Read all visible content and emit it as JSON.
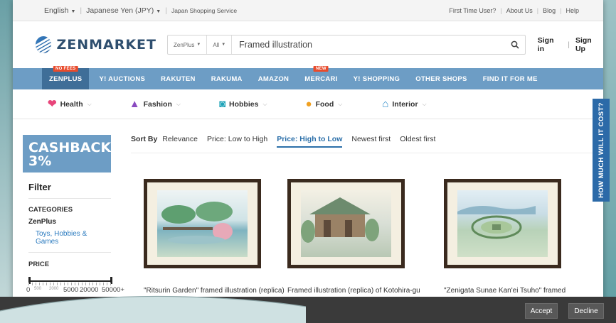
{
  "topbar": {
    "language": "English",
    "currency": "Japanese Yen (JPY)",
    "service": "Japan Shopping Service",
    "links": [
      "First Time User?",
      "About Us",
      "Blog",
      "Help"
    ]
  },
  "header": {
    "logo": "ZENMARKET",
    "search_scope": "ZenPlus",
    "search_category": "All",
    "search_value": "Framed illustration",
    "sign_in": "Sign in",
    "sign_up": "Sign Up"
  },
  "nav": {
    "items": [
      {
        "label": "ZENPLUS",
        "badge": "NO FEES"
      },
      {
        "label": "Y! AUCTIONS"
      },
      {
        "label": "RAKUTEN"
      },
      {
        "label": "RAKUMA"
      },
      {
        "label": "AMAZON"
      },
      {
        "label": "MERCARI",
        "badge": "NEW"
      },
      {
        "label": "Y! SHOPPING"
      },
      {
        "label": "OTHER SHOPS"
      },
      {
        "label": "FIND IT FOR ME"
      }
    ]
  },
  "categories": [
    {
      "label": "Health",
      "icon": "heart-icon"
    },
    {
      "label": "Fashion",
      "icon": "hat-icon"
    },
    {
      "label": "Hobbies",
      "icon": "camera-icon"
    },
    {
      "label": "Food",
      "icon": "food-icon"
    },
    {
      "label": "Interior",
      "icon": "house-icon"
    }
  ],
  "sidebar": {
    "cashback_line1": "CASHBACK",
    "cashback_line2": "3%",
    "filter_title": "Filter",
    "categories_label": "CATEGORIES",
    "category_group": "ZenPlus",
    "category_link": "Toys, Hobbies & Games",
    "price_label": "PRICE",
    "price_ticks": [
      "0",
      "500",
      "2000",
      "5000",
      "20000",
      "50000+"
    ]
  },
  "sort": {
    "label": "Sort By",
    "options": [
      "Relevance",
      "Price: Low to High",
      "Price: High to Low",
      "Newest first",
      "Oldest first"
    ],
    "active": "Price: High to Low"
  },
  "products": [
    {
      "title": "\"Ritsurin Garden\" framed illustration (replica)"
    },
    {
      "title": "Framed illustration (replica) of Kotohira-gu"
    },
    {
      "title": "\"Zenigata Sunae Kan'ei Tsuho\" framed"
    }
  ],
  "side_tab": "HOW MUCH WILL IT COST?",
  "cookie": {
    "accept": "Accept",
    "decline": "Decline"
  },
  "colors": {
    "nav_bg": "#6d9dc5",
    "nav_active": "#3f6e98",
    "badge": "#e84b2c",
    "link": "#2b7bbf",
    "side_tab": "#2c6aa8"
  }
}
